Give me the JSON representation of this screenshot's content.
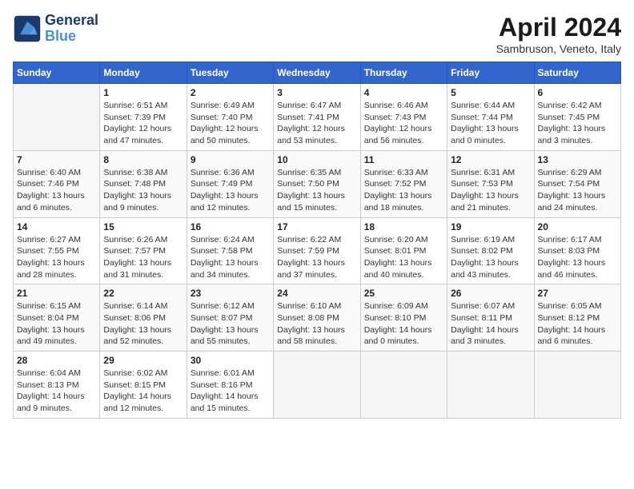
{
  "header": {
    "logo_line1": "General",
    "logo_line2": "Blue",
    "title": "April 2024",
    "subtitle": "Sambruson, Veneto, Italy"
  },
  "columns": [
    "Sunday",
    "Monday",
    "Tuesday",
    "Wednesday",
    "Thursday",
    "Friday",
    "Saturday"
  ],
  "weeks": [
    [
      {
        "num": "",
        "info": ""
      },
      {
        "num": "1",
        "info": "Sunrise: 6:51 AM\nSunset: 7:39 PM\nDaylight: 12 hours\nand 47 minutes."
      },
      {
        "num": "2",
        "info": "Sunrise: 6:49 AM\nSunset: 7:40 PM\nDaylight: 12 hours\nand 50 minutes."
      },
      {
        "num": "3",
        "info": "Sunrise: 6:47 AM\nSunset: 7:41 PM\nDaylight: 12 hours\nand 53 minutes."
      },
      {
        "num": "4",
        "info": "Sunrise: 6:46 AM\nSunset: 7:43 PM\nDaylight: 12 hours\nand 56 minutes."
      },
      {
        "num": "5",
        "info": "Sunrise: 6:44 AM\nSunset: 7:44 PM\nDaylight: 13 hours\nand 0 minutes."
      },
      {
        "num": "6",
        "info": "Sunrise: 6:42 AM\nSunset: 7:45 PM\nDaylight: 13 hours\nand 3 minutes."
      }
    ],
    [
      {
        "num": "7",
        "info": "Sunrise: 6:40 AM\nSunset: 7:46 PM\nDaylight: 13 hours\nand 6 minutes."
      },
      {
        "num": "8",
        "info": "Sunrise: 6:38 AM\nSunset: 7:48 PM\nDaylight: 13 hours\nand 9 minutes."
      },
      {
        "num": "9",
        "info": "Sunrise: 6:36 AM\nSunset: 7:49 PM\nDaylight: 13 hours\nand 12 minutes."
      },
      {
        "num": "10",
        "info": "Sunrise: 6:35 AM\nSunset: 7:50 PM\nDaylight: 13 hours\nand 15 minutes."
      },
      {
        "num": "11",
        "info": "Sunrise: 6:33 AM\nSunset: 7:52 PM\nDaylight: 13 hours\nand 18 minutes."
      },
      {
        "num": "12",
        "info": "Sunrise: 6:31 AM\nSunset: 7:53 PM\nDaylight: 13 hours\nand 21 minutes."
      },
      {
        "num": "13",
        "info": "Sunrise: 6:29 AM\nSunset: 7:54 PM\nDaylight: 13 hours\nand 24 minutes."
      }
    ],
    [
      {
        "num": "14",
        "info": "Sunrise: 6:27 AM\nSunset: 7:55 PM\nDaylight: 13 hours\nand 28 minutes."
      },
      {
        "num": "15",
        "info": "Sunrise: 6:26 AM\nSunset: 7:57 PM\nDaylight: 13 hours\nand 31 minutes."
      },
      {
        "num": "16",
        "info": "Sunrise: 6:24 AM\nSunset: 7:58 PM\nDaylight: 13 hours\nand 34 minutes."
      },
      {
        "num": "17",
        "info": "Sunrise: 6:22 AM\nSunset: 7:59 PM\nDaylight: 13 hours\nand 37 minutes."
      },
      {
        "num": "18",
        "info": "Sunrise: 6:20 AM\nSunset: 8:01 PM\nDaylight: 13 hours\nand 40 minutes."
      },
      {
        "num": "19",
        "info": "Sunrise: 6:19 AM\nSunset: 8:02 PM\nDaylight: 13 hours\nand 43 minutes."
      },
      {
        "num": "20",
        "info": "Sunrise: 6:17 AM\nSunset: 8:03 PM\nDaylight: 13 hours\nand 46 minutes."
      }
    ],
    [
      {
        "num": "21",
        "info": "Sunrise: 6:15 AM\nSunset: 8:04 PM\nDaylight: 13 hours\nand 49 minutes."
      },
      {
        "num": "22",
        "info": "Sunrise: 6:14 AM\nSunset: 8:06 PM\nDaylight: 13 hours\nand 52 minutes."
      },
      {
        "num": "23",
        "info": "Sunrise: 6:12 AM\nSunset: 8:07 PM\nDaylight: 13 hours\nand 55 minutes."
      },
      {
        "num": "24",
        "info": "Sunrise: 6:10 AM\nSunset: 8:08 PM\nDaylight: 13 hours\nand 58 minutes."
      },
      {
        "num": "25",
        "info": "Sunrise: 6:09 AM\nSunset: 8:10 PM\nDaylight: 14 hours\nand 0 minutes."
      },
      {
        "num": "26",
        "info": "Sunrise: 6:07 AM\nSunset: 8:11 PM\nDaylight: 14 hours\nand 3 minutes."
      },
      {
        "num": "27",
        "info": "Sunrise: 6:05 AM\nSunset: 8:12 PM\nDaylight: 14 hours\nand 6 minutes."
      }
    ],
    [
      {
        "num": "28",
        "info": "Sunrise: 6:04 AM\nSunset: 8:13 PM\nDaylight: 14 hours\nand 9 minutes."
      },
      {
        "num": "29",
        "info": "Sunrise: 6:02 AM\nSunset: 8:15 PM\nDaylight: 14 hours\nand 12 minutes."
      },
      {
        "num": "30",
        "info": "Sunrise: 6:01 AM\nSunset: 8:16 PM\nDaylight: 14 hours\nand 15 minutes."
      },
      {
        "num": "",
        "info": ""
      },
      {
        "num": "",
        "info": ""
      },
      {
        "num": "",
        "info": ""
      },
      {
        "num": "",
        "info": ""
      }
    ]
  ]
}
